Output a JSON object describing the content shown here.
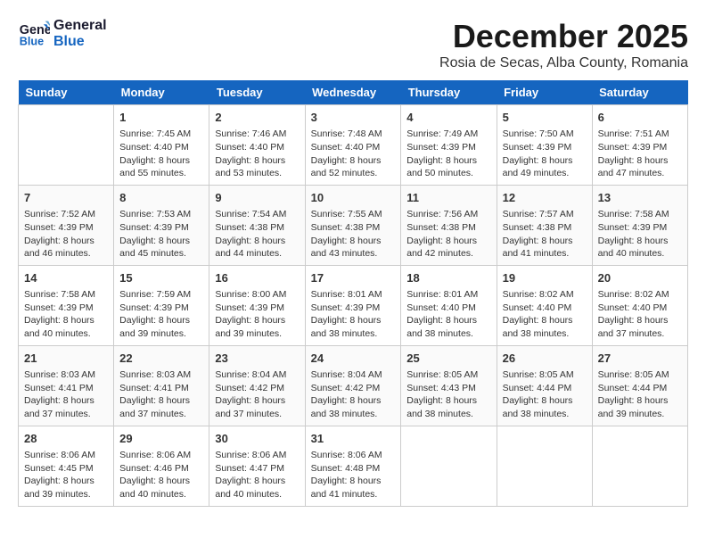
{
  "header": {
    "logo_line1": "General",
    "logo_line2": "Blue",
    "month": "December 2025",
    "location": "Rosia de Secas, Alba County, Romania"
  },
  "days_of_week": [
    "Sunday",
    "Monday",
    "Tuesday",
    "Wednesday",
    "Thursday",
    "Friday",
    "Saturday"
  ],
  "weeks": [
    [
      {
        "day": "",
        "info": ""
      },
      {
        "day": "1",
        "info": "Sunrise: 7:45 AM\nSunset: 4:40 PM\nDaylight: 8 hours\nand 55 minutes."
      },
      {
        "day": "2",
        "info": "Sunrise: 7:46 AM\nSunset: 4:40 PM\nDaylight: 8 hours\nand 53 minutes."
      },
      {
        "day": "3",
        "info": "Sunrise: 7:48 AM\nSunset: 4:40 PM\nDaylight: 8 hours\nand 52 minutes."
      },
      {
        "day": "4",
        "info": "Sunrise: 7:49 AM\nSunset: 4:39 PM\nDaylight: 8 hours\nand 50 minutes."
      },
      {
        "day": "5",
        "info": "Sunrise: 7:50 AM\nSunset: 4:39 PM\nDaylight: 8 hours\nand 49 minutes."
      },
      {
        "day": "6",
        "info": "Sunrise: 7:51 AM\nSunset: 4:39 PM\nDaylight: 8 hours\nand 47 minutes."
      }
    ],
    [
      {
        "day": "7",
        "info": "Sunrise: 7:52 AM\nSunset: 4:39 PM\nDaylight: 8 hours\nand 46 minutes."
      },
      {
        "day": "8",
        "info": "Sunrise: 7:53 AM\nSunset: 4:39 PM\nDaylight: 8 hours\nand 45 minutes."
      },
      {
        "day": "9",
        "info": "Sunrise: 7:54 AM\nSunset: 4:38 PM\nDaylight: 8 hours\nand 44 minutes."
      },
      {
        "day": "10",
        "info": "Sunrise: 7:55 AM\nSunset: 4:38 PM\nDaylight: 8 hours\nand 43 minutes."
      },
      {
        "day": "11",
        "info": "Sunrise: 7:56 AM\nSunset: 4:38 PM\nDaylight: 8 hours\nand 42 minutes."
      },
      {
        "day": "12",
        "info": "Sunrise: 7:57 AM\nSunset: 4:38 PM\nDaylight: 8 hours\nand 41 minutes."
      },
      {
        "day": "13",
        "info": "Sunrise: 7:58 AM\nSunset: 4:39 PM\nDaylight: 8 hours\nand 40 minutes."
      }
    ],
    [
      {
        "day": "14",
        "info": "Sunrise: 7:58 AM\nSunset: 4:39 PM\nDaylight: 8 hours\nand 40 minutes."
      },
      {
        "day": "15",
        "info": "Sunrise: 7:59 AM\nSunset: 4:39 PM\nDaylight: 8 hours\nand 39 minutes."
      },
      {
        "day": "16",
        "info": "Sunrise: 8:00 AM\nSunset: 4:39 PM\nDaylight: 8 hours\nand 39 minutes."
      },
      {
        "day": "17",
        "info": "Sunrise: 8:01 AM\nSunset: 4:39 PM\nDaylight: 8 hours\nand 38 minutes."
      },
      {
        "day": "18",
        "info": "Sunrise: 8:01 AM\nSunset: 4:40 PM\nDaylight: 8 hours\nand 38 minutes."
      },
      {
        "day": "19",
        "info": "Sunrise: 8:02 AM\nSunset: 4:40 PM\nDaylight: 8 hours\nand 38 minutes."
      },
      {
        "day": "20",
        "info": "Sunrise: 8:02 AM\nSunset: 4:40 PM\nDaylight: 8 hours\nand 37 minutes."
      }
    ],
    [
      {
        "day": "21",
        "info": "Sunrise: 8:03 AM\nSunset: 4:41 PM\nDaylight: 8 hours\nand 37 minutes."
      },
      {
        "day": "22",
        "info": "Sunrise: 8:03 AM\nSunset: 4:41 PM\nDaylight: 8 hours\nand 37 minutes."
      },
      {
        "day": "23",
        "info": "Sunrise: 8:04 AM\nSunset: 4:42 PM\nDaylight: 8 hours\nand 37 minutes."
      },
      {
        "day": "24",
        "info": "Sunrise: 8:04 AM\nSunset: 4:42 PM\nDaylight: 8 hours\nand 38 minutes."
      },
      {
        "day": "25",
        "info": "Sunrise: 8:05 AM\nSunset: 4:43 PM\nDaylight: 8 hours\nand 38 minutes."
      },
      {
        "day": "26",
        "info": "Sunrise: 8:05 AM\nSunset: 4:44 PM\nDaylight: 8 hours\nand 38 minutes."
      },
      {
        "day": "27",
        "info": "Sunrise: 8:05 AM\nSunset: 4:44 PM\nDaylight: 8 hours\nand 39 minutes."
      }
    ],
    [
      {
        "day": "28",
        "info": "Sunrise: 8:06 AM\nSunset: 4:45 PM\nDaylight: 8 hours\nand 39 minutes."
      },
      {
        "day": "29",
        "info": "Sunrise: 8:06 AM\nSunset: 4:46 PM\nDaylight: 8 hours\nand 40 minutes."
      },
      {
        "day": "30",
        "info": "Sunrise: 8:06 AM\nSunset: 4:47 PM\nDaylight: 8 hours\nand 40 minutes."
      },
      {
        "day": "31",
        "info": "Sunrise: 8:06 AM\nSunset: 4:48 PM\nDaylight: 8 hours\nand 41 minutes."
      },
      {
        "day": "",
        "info": ""
      },
      {
        "day": "",
        "info": ""
      },
      {
        "day": "",
        "info": ""
      }
    ]
  ]
}
